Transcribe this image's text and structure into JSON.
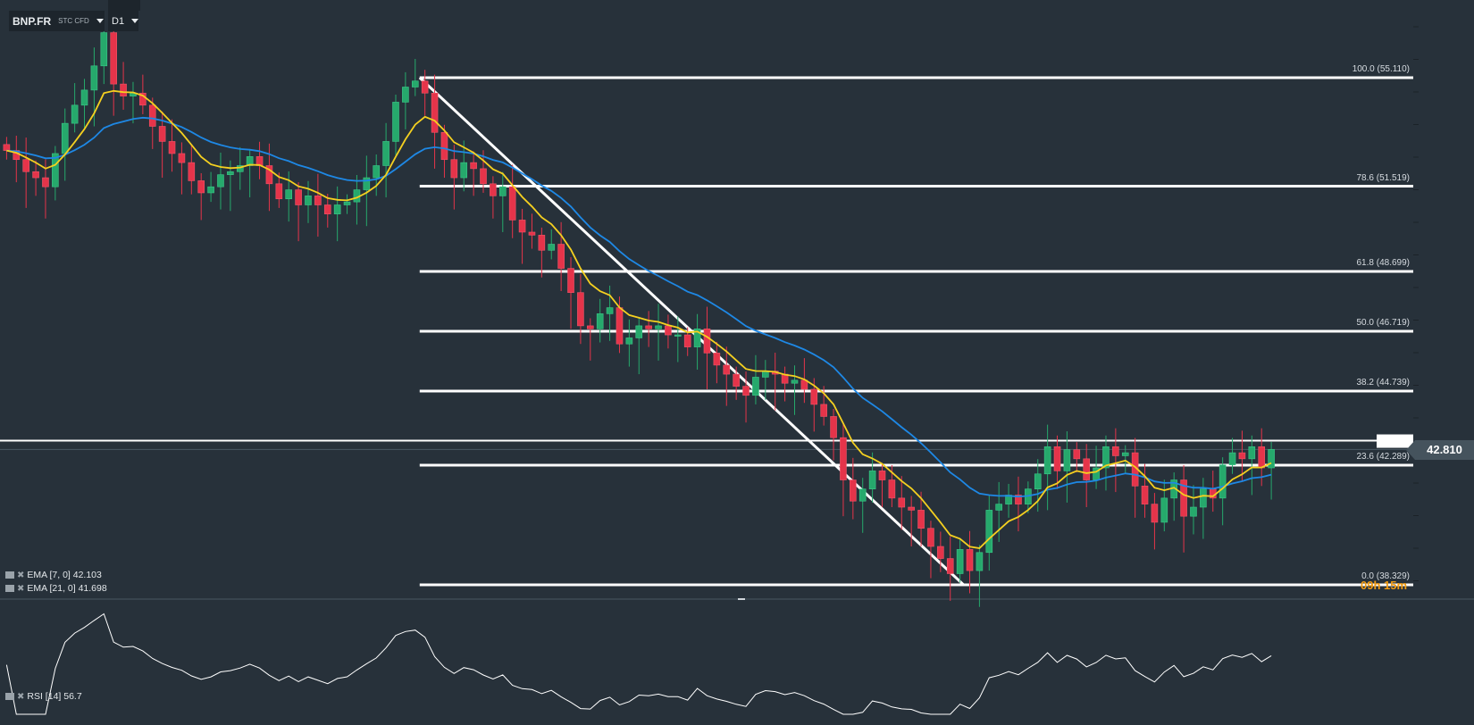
{
  "header": {
    "symbol": "BNP.FR",
    "instrument_type": "STC CFD",
    "timeframe": "D1"
  },
  "current_price": "42.810",
  "countdown": "09h 15m",
  "indicators": {
    "ema7": {
      "label": "EMA [7, 0] 42.103",
      "color": "#f5d020"
    },
    "ema21": {
      "label": "EMA [21, 0] 41.698",
      "color": "#1e88e5"
    },
    "rsi": {
      "label": "RSI [14] 56.7"
    }
  },
  "colors": {
    "background": "#27313a",
    "up": "#26a96c",
    "down": "#e5344a",
    "fib": "#ffffff"
  },
  "chart_data": {
    "type": "candlestick",
    "ylim": [
      37.6,
      57.7
    ],
    "closes": [
      52.7,
      52.4,
      52.0,
      51.8,
      51.5,
      52.6,
      53.6,
      54.2,
      54.7,
      55.5,
      56.6,
      54.9,
      54.5,
      54.6,
      54.2,
      53.5,
      53.0,
      52.6,
      52.3,
      51.7,
      51.3,
      51.5,
      51.9,
      52.0,
      52.2,
      52.5,
      52.2,
      51.6,
      51.1,
      51.4,
      50.9,
      51.2,
      50.9,
      50.6,
      50.9,
      51.0,
      51.4,
      51.8,
      52.2,
      53.0,
      54.3,
      54.8,
      55.0,
      54.6,
      53.3,
      52.4,
      51.8,
      52.3,
      52.1,
      51.6,
      51.2,
      51.5,
      50.4,
      50.0,
      49.9,
      49.4,
      49.6,
      48.8,
      48.0,
      46.9,
      46.8,
      47.3,
      47.5,
      46.3,
      46.5,
      46.9,
      46.8,
      46.9,
      46.6,
      46.6,
      46.2,
      46.8,
      46.0,
      45.6,
      45.3,
      44.9,
      44.6,
      45.2,
      45.4,
      45.3,
      45.0,
      45.1,
      44.8,
      44.3,
      43.9,
      43.2,
      41.8,
      41.1,
      41.5,
      42.1,
      41.8,
      41.2,
      40.9,
      40.8,
      40.2,
      39.6,
      39.2,
      38.7,
      39.5,
      38.8,
      39.4,
      40.8,
      41.0,
      41.3,
      41.0,
      41.5,
      42.0,
      42.9,
      42.1,
      42.8,
      42.5,
      41.8,
      42.2,
      42.9,
      42.6,
      42.7,
      41.6,
      41.0,
      40.4,
      41.2,
      41.8,
      40.6,
      40.9,
      41.5,
      41.2,
      42.3,
      42.7,
      42.5,
      42.9,
      42.2,
      42.81
    ],
    "fibonacci": {
      "start_candle": 42,
      "end_candle": 97,
      "levels": [
        {
          "pct": 100.0,
          "price": 55.11,
          "label": "100.0 (55.110)"
        },
        {
          "pct": 78.6,
          "price": 51.519,
          "label": "78.6 (51.519)"
        },
        {
          "pct": 61.8,
          "price": 48.699,
          "label": "61.8 (48.699)"
        },
        {
          "pct": 50.0,
          "price": 46.719,
          "label": "50.0 (46.719)"
        },
        {
          "pct": 38.2,
          "price": 44.739,
          "label": "38.2 (44.739)"
        },
        {
          "pct": 23.6,
          "price": 42.289,
          "label": "23.6 (42.289)"
        },
        {
          "pct": 0.0,
          "price": 38.329,
          "label": "0.0 (38.329)"
        }
      ]
    },
    "horizontal_line_price": 43.1,
    "rsi_range": [
      20,
      85
    ]
  }
}
